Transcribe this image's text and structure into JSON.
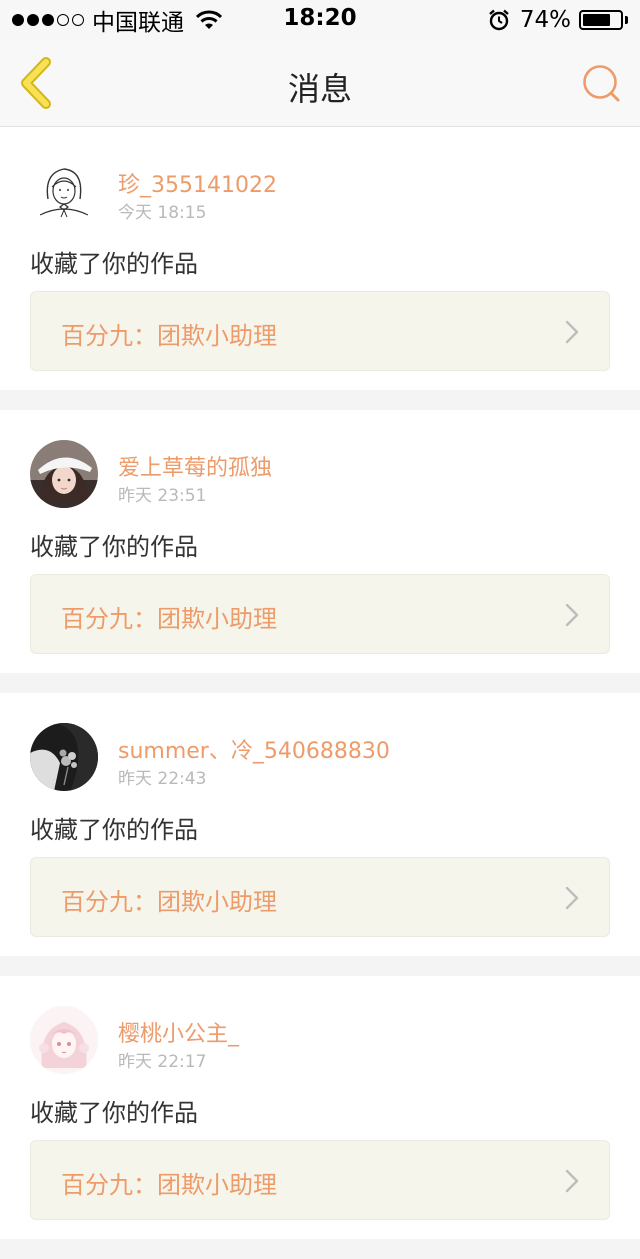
{
  "status_bar": {
    "carrier": "中国联通",
    "time": "18:20",
    "battery_percent": "74%",
    "battery_level": 0.74,
    "signal_bars_filled": 3,
    "signal_bars_total": 5,
    "icons": [
      "signal-dots-icon",
      "wifi-icon",
      "alarm-icon",
      "battery-icon"
    ]
  },
  "nav": {
    "title": "消息",
    "back_icon": "chevron-left-icon",
    "search_icon": "search-icon"
  },
  "colors": {
    "accent": "#ee9b6a",
    "back_arrow": "#f1d230",
    "card_link_bg": "#f6f5ec",
    "page_bg": "#f5f4f4"
  },
  "notifications": [
    {
      "username": "珍_355141022",
      "time": "今天 18:15",
      "action": "收藏了你的作品",
      "work_title": "百分九：团欺小助理",
      "avatar": "sketch-girl-avatar"
    },
    {
      "username": "爱上草莓的孤独",
      "time": "昨天 23:51",
      "action": "收藏了你的作品",
      "work_title": "百分九：团欺小助理",
      "avatar": "girl-white-cap-avatar"
    },
    {
      "username": "summer、冷_540688830",
      "time": "昨天 22:43",
      "action": "收藏了你的作品",
      "work_title": "百分九：团欺小助理",
      "avatar": "bw-flowers-avatar"
    },
    {
      "username": "樱桃小公主_",
      "time": "昨天 22:17",
      "action": "收藏了你的作品",
      "work_title": "百分九：团欺小助理",
      "avatar": "pink-anime-girl-avatar"
    }
  ]
}
